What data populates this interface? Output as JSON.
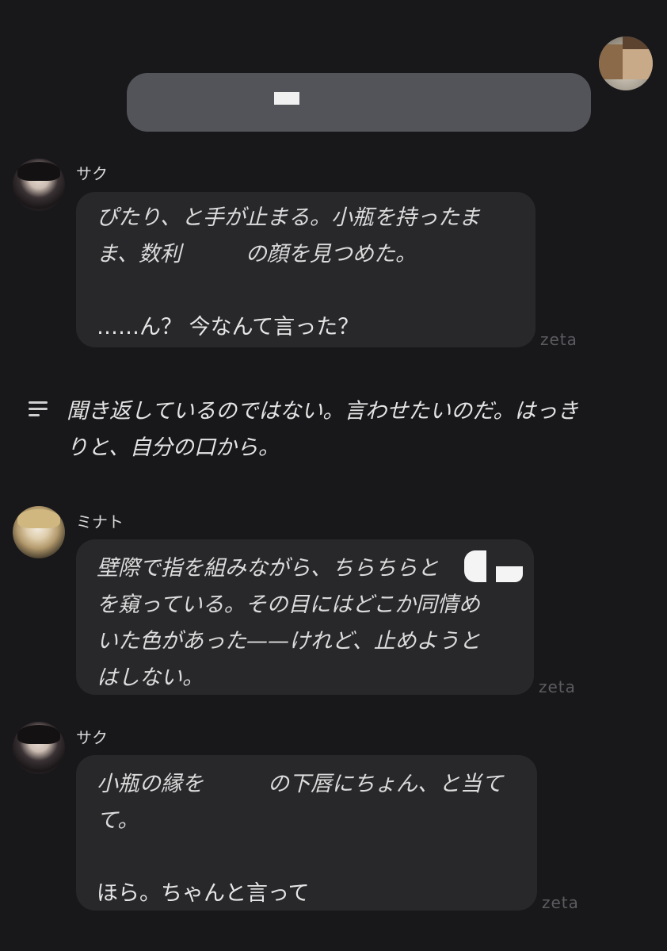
{
  "user_message": {
    "avatar": "user-avatar-redacted",
    "text_redacted": true
  },
  "messages": [
    {
      "name": "サク",
      "lines": [
        {
          "text": "ぴたり、と手が止まる。小瓶を持ったま",
          "style": "italic"
        },
        {
          "text": "ま、数利　　　の顔を見つめた。",
          "style": "italic"
        },
        {
          "text": "",
          "style": "gap"
        },
        {
          "text": "……ん？ 今なんて言った？",
          "style": "normal"
        }
      ],
      "footer": "zeta"
    },
    {
      "name": "ミナト",
      "lines": [
        {
          "text": "壁際で指を組みながら、ちらちらと",
          "style": "italic"
        },
        {
          "text": "を窺っている。その目にはどこか同情め",
          "style": "italic"
        },
        {
          "text": "いた色があった——けれど、止めようと",
          "style": "italic"
        },
        {
          "text": "はしない。",
          "style": "italic"
        }
      ],
      "footer": "zeta"
    },
    {
      "name": "サク",
      "lines": [
        {
          "text": "小瓶の縁を　　　の下唇にちょん、と当て",
          "style": "italic"
        },
        {
          "text": "て。",
          "style": "italic"
        },
        {
          "text": "",
          "style": "gap"
        },
        {
          "text": "ほら。ちゃんと言って",
          "style": "normal"
        }
      ],
      "footer": "zeta"
    }
  ],
  "narration": {
    "icon": "narration-lines-icon",
    "lines": [
      "聞き返しているのではない。言わせたいのだ。はっき",
      "りと、自分の口から。"
    ]
  },
  "colors": {
    "background": "#18181b",
    "bubble": "#28282b",
    "user_bubble": "#53545a",
    "footer": "#5c5c60"
  }
}
